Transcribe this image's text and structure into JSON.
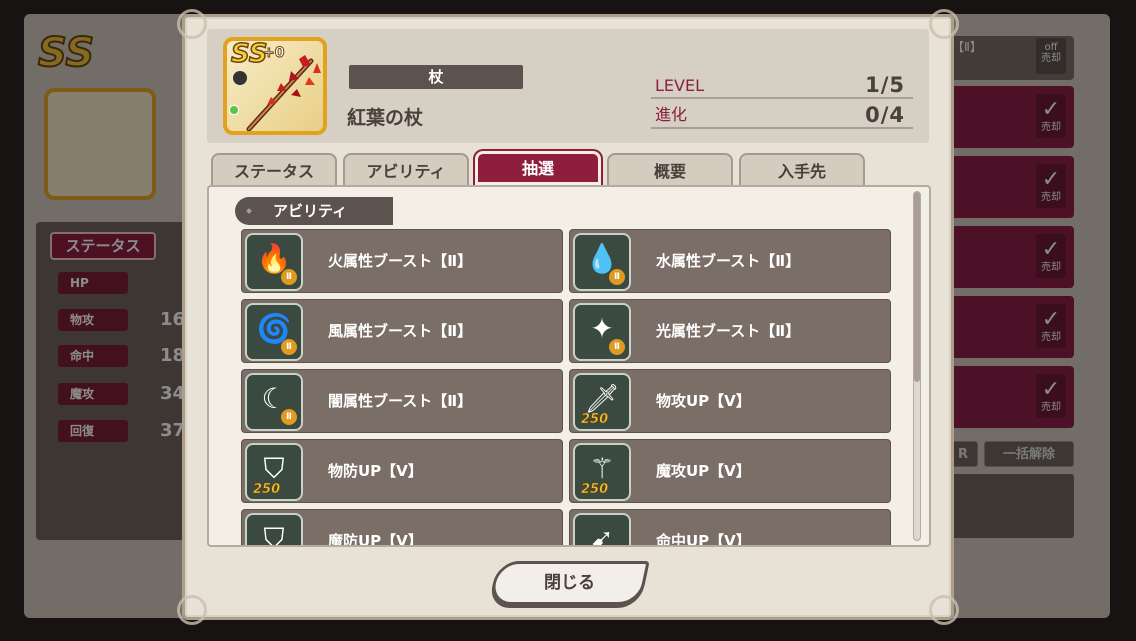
{
  "background": {
    "status_button": "ステータス",
    "stats": [
      {
        "label": "HP",
        "value": ""
      },
      {
        "label": "物攻",
        "value": "16"
      },
      {
        "label": "命中",
        "value": "18"
      },
      {
        "label": "魔攻",
        "value": "34"
      },
      {
        "label": "回復",
        "value": "37"
      }
    ],
    "right_top_label": "【Ⅱ】",
    "right_top_toggle": "off",
    "sell_label": "売却",
    "bulk_release_button": "一括解除",
    "partial_button": "R"
  },
  "modal": {
    "item": {
      "rarity": "SS",
      "plus": "+0",
      "type": "杖",
      "name": "紅葉の杖"
    },
    "level": {
      "label": "LEVEL",
      "value": "1/5"
    },
    "evolution": {
      "label": "進化",
      "value": "0/4"
    },
    "tabs": [
      "ステータス",
      "アビリティ",
      "抽選",
      "概要",
      "入手先"
    ],
    "active_tab": "抽選",
    "section_title": "アビリティ",
    "abilities": [
      {
        "name": "火属性ブースト【Ⅱ】",
        "icon": "fire-icon",
        "badge": "Ⅱ"
      },
      {
        "name": "水属性ブースト【Ⅱ】",
        "icon": "water-drop-icon",
        "badge": "Ⅱ"
      },
      {
        "name": "風属性ブースト【Ⅱ】",
        "icon": "wind-icon",
        "badge": "Ⅱ"
      },
      {
        "name": "光属性ブースト【Ⅱ】",
        "icon": "light-icon",
        "badge": "Ⅱ"
      },
      {
        "name": "闇属性ブースト【Ⅱ】",
        "icon": "dark-moon-icon",
        "badge": "Ⅱ"
      },
      {
        "name": "物攻UP【Ⅴ】",
        "icon": "sword-icon",
        "badge": "250"
      },
      {
        "name": "物防UP【Ⅴ】",
        "icon": "shield-sword-icon",
        "badge": "250"
      },
      {
        "name": "魔攻UP【Ⅴ】",
        "icon": "magic-staff-icon",
        "badge": "250"
      },
      {
        "name": "魔防UP【Ⅴ】",
        "icon": "magic-shield-icon",
        "badge": ""
      },
      {
        "name": "命中UP【Ⅴ】",
        "icon": "accuracy-icon",
        "badge": ""
      }
    ],
    "close_button": "閉じる"
  }
}
